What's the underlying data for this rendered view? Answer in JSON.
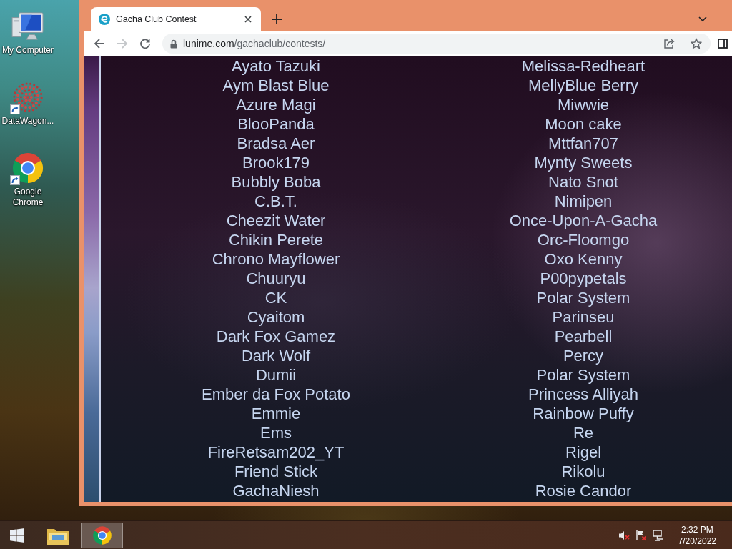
{
  "desktop": {
    "icons": [
      {
        "kind": "computer",
        "label": "My Computer",
        "shortcut": false
      },
      {
        "kind": "dots",
        "label": "DataWagon...",
        "shortcut": true
      },
      {
        "kind": "browser",
        "label": "Google Chrome",
        "shortcut": true
      }
    ]
  },
  "browser": {
    "tabs": [
      {
        "title": "Gacha Club Contest",
        "selected": true
      }
    ],
    "nav": {
      "back_disabled": false,
      "forward_disabled": true
    },
    "address": {
      "host": "lunime.com",
      "path": "/gachaclub/contests/"
    }
  },
  "page": {
    "columns": [
      {
        "names": [
          "Ayato Tazuki",
          "Aym Blast Blue",
          "Azure Magi",
          "BlooPanda",
          "Bradsa Aer",
          "Brook179",
          "Bubbly Boba",
          "C.B.T.",
          "Cheezit Water",
          "Chikin Perete",
          "Chrono Mayflower",
          "Chuuryu",
          "CK",
          "Cyaitom",
          "Dark Fox Gamez",
          "Dark Wolf",
          "Dumii",
          "Ember da Fox Potato",
          "Emmie",
          "Ems",
          "FireRetsam202_YT",
          "Friend Stick",
          "GachaNiesh"
        ]
      },
      {
        "names": [
          "Melissa-Redheart",
          "MellyBlue Berry",
          "Miwwie",
          "Moon cake",
          "Mttfan707",
          "Mynty Sweets",
          "Nato Snot",
          "Nimipen",
          "Once-Upon-A-Gacha",
          "Orc-Floomgo",
          "Oxo Kenny",
          "P00pypetals",
          "Polar System",
          "Parinseu",
          "Pearbell",
          "Percy",
          "Polar System",
          "Princess Alliyah",
          "Rainbow Puffy",
          "Re",
          "Rigel",
          "Rikolu",
          "Rosie Candor"
        ]
      }
    ]
  },
  "taskbar": {
    "apps": [
      {
        "kind": "explorer",
        "selected": false
      },
      {
        "kind": "browser",
        "selected": true
      }
    ],
    "tray": {
      "muted": true,
      "time": "2:32 PM",
      "date": "7/20/2022"
    }
  }
}
